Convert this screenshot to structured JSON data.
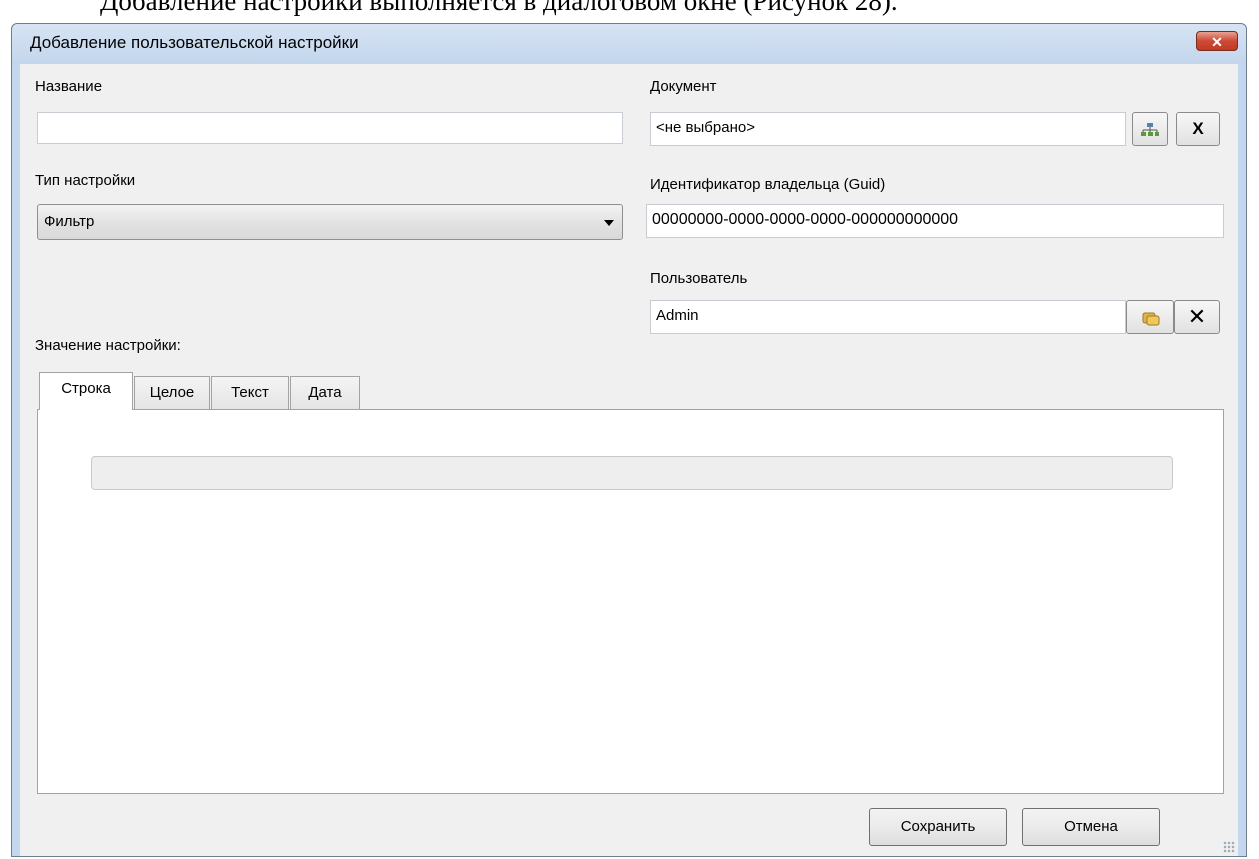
{
  "document_caption": "Добавление настройки выполняется в диалоговом окне (Рисунок 28).",
  "window": {
    "title": "Добавление пользовательской настройки",
    "close_icon": "close-x-icon"
  },
  "form": {
    "name": {
      "label": "Название",
      "value": ""
    },
    "document": {
      "label": "Документ",
      "value": "<не выбрано>",
      "pick_icon": "hierarchy-icon",
      "clear_label": "X"
    },
    "setting_type": {
      "label": "Тип настройки",
      "selected": "Фильтр"
    },
    "owner_id": {
      "label": "Идентификатор владельца (Guid)",
      "value": "00000000-0000-0000-0000-000000000000"
    },
    "user": {
      "label": "Пользователь",
      "value": "Admin",
      "pick_icon": "users-icon",
      "clear_label": "✕"
    },
    "value_label": "Значение настройки:"
  },
  "tabs": [
    {
      "label": "Строка",
      "active": true
    },
    {
      "label": "Целое",
      "active": false
    },
    {
      "label": "Текст",
      "active": false
    },
    {
      "label": "Дата",
      "active": false
    }
  ],
  "buttons": {
    "save": "Сохранить",
    "cancel": "Отмена"
  },
  "colors": {
    "close_button": "#c7432c",
    "window_frame": "#c4d7ee",
    "dialog_background": "#f0f0f0"
  }
}
